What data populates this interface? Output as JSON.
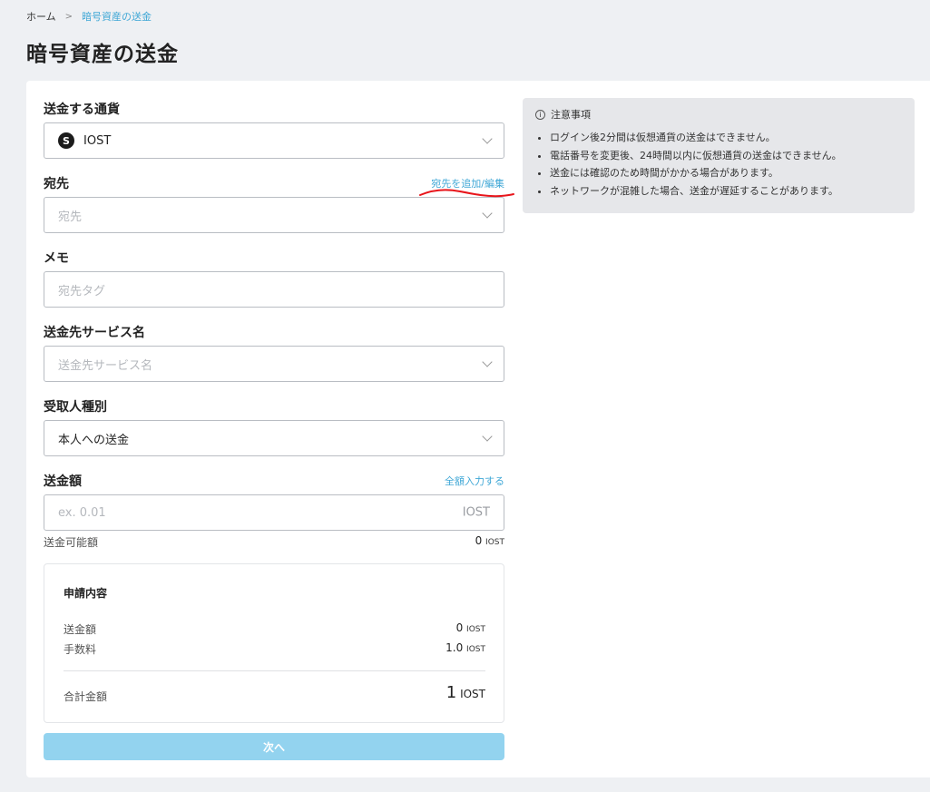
{
  "breadcrumb": {
    "home": "ホーム",
    "separator": ">",
    "current": "暗号資産の送金"
  },
  "page_title": "暗号資産の送金",
  "form": {
    "currency": {
      "label": "送金する通貨",
      "value": "IOST",
      "logo_glyph": "S"
    },
    "destination": {
      "label": "宛先",
      "link": "宛先を追加/編集",
      "placeholder": "宛先"
    },
    "memo": {
      "label": "メモ",
      "placeholder": "宛先タグ"
    },
    "service": {
      "label": "送金先サービス名",
      "placeholder": "送金先サービス名"
    },
    "recipient_type": {
      "label": "受取人種別",
      "value": "本人への送金"
    },
    "amount": {
      "label": "送金額",
      "link": "全額入力する",
      "placeholder": "ex. 0.01",
      "unit": "IOST"
    },
    "available": {
      "label": "送金可能額",
      "value": "0",
      "unit": "IOST"
    }
  },
  "summary": {
    "title": "申請内容",
    "amount_label": "送金額",
    "amount_value": "0",
    "amount_unit": "IOST",
    "fee_label": "手数料",
    "fee_value": "1.0",
    "fee_unit": "IOST",
    "total_label": "合計金額",
    "total_value": "1",
    "total_unit": "IOST"
  },
  "next_button": "次へ",
  "notice": {
    "title": "注意事項",
    "items": [
      "ログイン後2分間は仮想通貨の送金はできません。",
      "電話番号を変更後、24時間以内に仮想通貨の送金はできません。",
      "送金には確認のため時間がかかる場合があります。",
      "ネットワークが混雑した場合、送金が遅延することがあります。"
    ]
  },
  "colors": {
    "accent": "#3fa7d6",
    "button": "#93d3ef",
    "annotation": "#e8151b"
  }
}
